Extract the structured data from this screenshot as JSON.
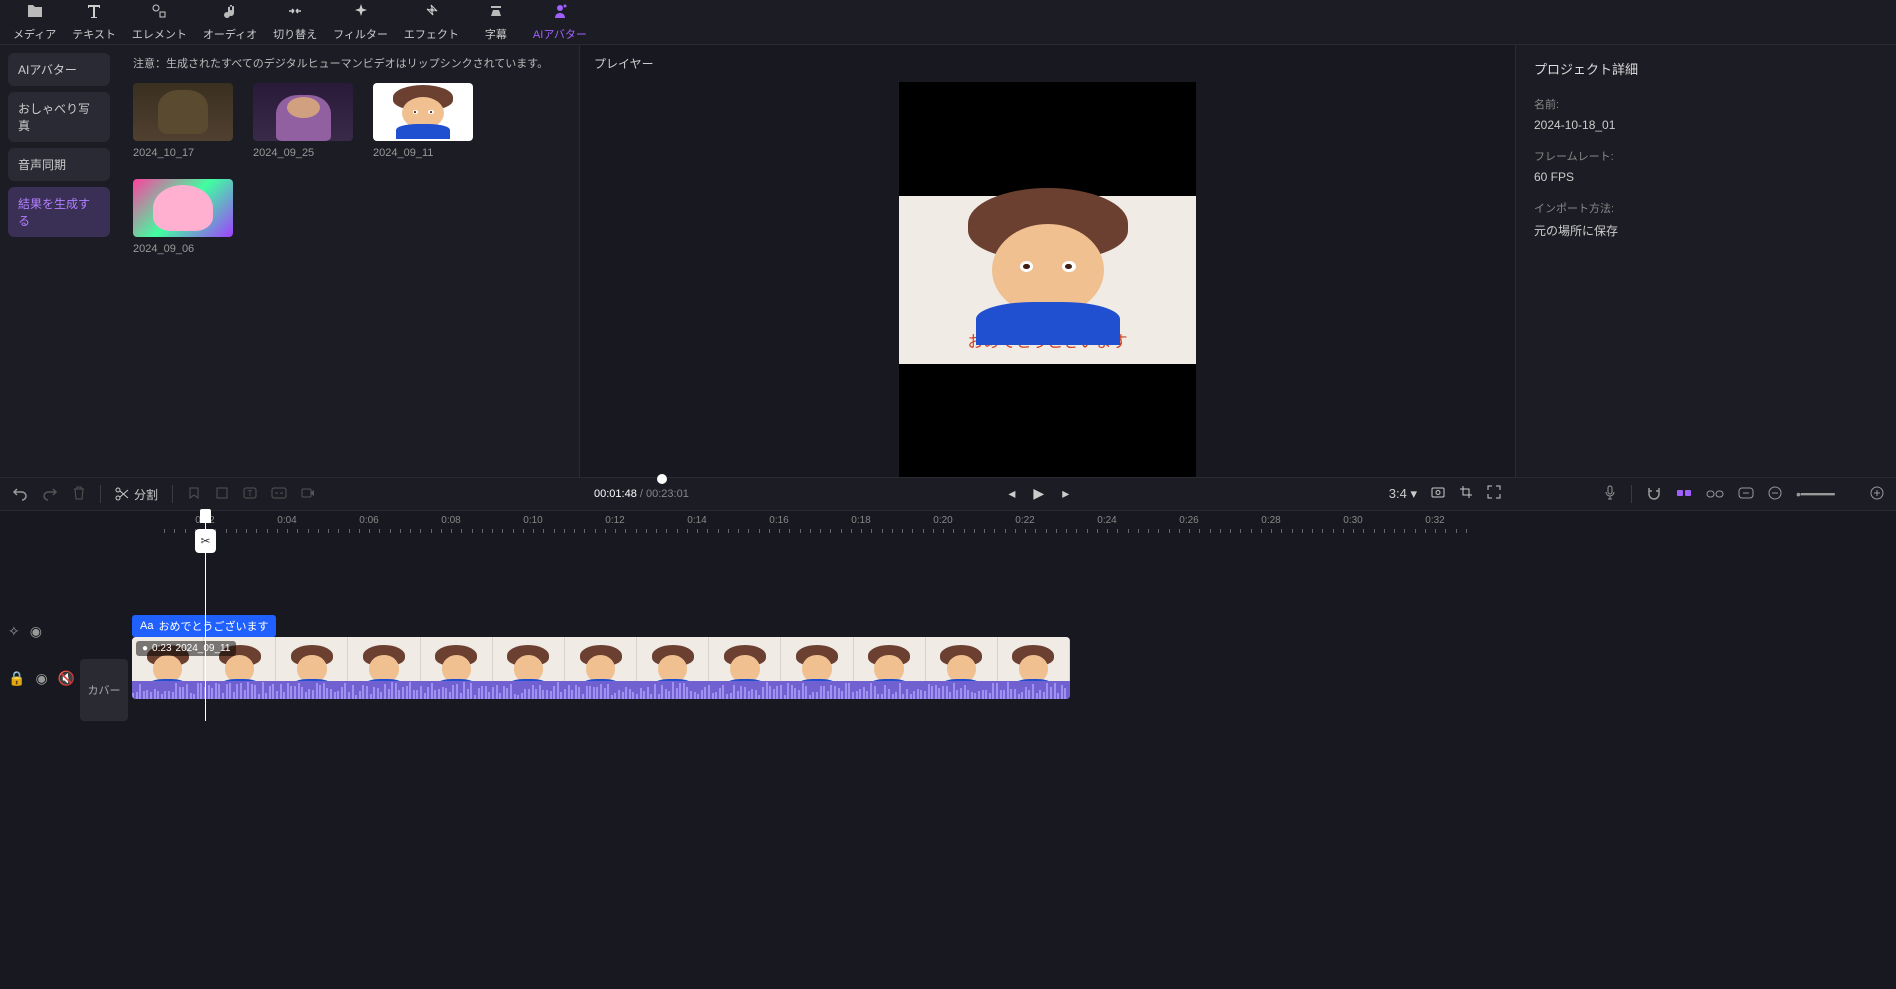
{
  "topTabs": [
    {
      "label": "メディア",
      "icon": "folder"
    },
    {
      "label": "テキスト",
      "icon": "text"
    },
    {
      "label": "エレメント",
      "icon": "elements"
    },
    {
      "label": "オーディオ",
      "icon": "audio"
    },
    {
      "label": "切り替え",
      "icon": "transition"
    },
    {
      "label": "フィルター",
      "icon": "filter"
    },
    {
      "label": "エフェクト",
      "icon": "effect"
    },
    {
      "label": "字幕",
      "icon": "subtitle"
    },
    {
      "label": "AIアバター",
      "icon": "avatar",
      "active": true
    }
  ],
  "sidebar": {
    "items": [
      {
        "label": "AIアバター"
      },
      {
        "label": "おしゃべり写真"
      },
      {
        "label": "音声同期"
      },
      {
        "label": "結果を生成する",
        "active": true
      }
    ]
  },
  "content": {
    "notice": "注意：生成されたすべてのデジタルヒューマンビデオはリップシンクされています。",
    "thumbs": [
      {
        "label": "2024_10_17",
        "type": "mona"
      },
      {
        "label": "2024_09_25",
        "type": "woman"
      },
      {
        "label": "2024_09_11",
        "type": "boy"
      },
      {
        "label": "2024_09_06",
        "type": "colorful"
      }
    ]
  },
  "player": {
    "title": "プレイヤー",
    "subtitle": "おめでとうございます",
    "currentTime": "00:01:48",
    "totalTime": "00:23:01",
    "aspectRatio": "3:4"
  },
  "details": {
    "title": "プロジェクト詳細",
    "nameLabel": "名前:",
    "nameValue": "2024-10-18_01",
    "framerateLabel": "フレームレート:",
    "framerateValue": "60 FPS",
    "importLabel": "インポート方法:",
    "importValue": "元の場所に保存"
  },
  "toolbar": {
    "splitLabel": "分割"
  },
  "timeline": {
    "marks": [
      "0:02",
      "0:04",
      "0:06",
      "0:08",
      "0:10",
      "0:12",
      "0:14",
      "0:16",
      "0:18",
      "0:20",
      "0:22",
      "0:24",
      "0:26",
      "0:28",
      "0:30",
      "0:32"
    ],
    "coverLabel": "カバー",
    "textClip": {
      "icon": "Aa",
      "label": "おめでとうございます"
    },
    "videoClip": {
      "duration": "0:23",
      "name": "2024_09_11"
    }
  }
}
